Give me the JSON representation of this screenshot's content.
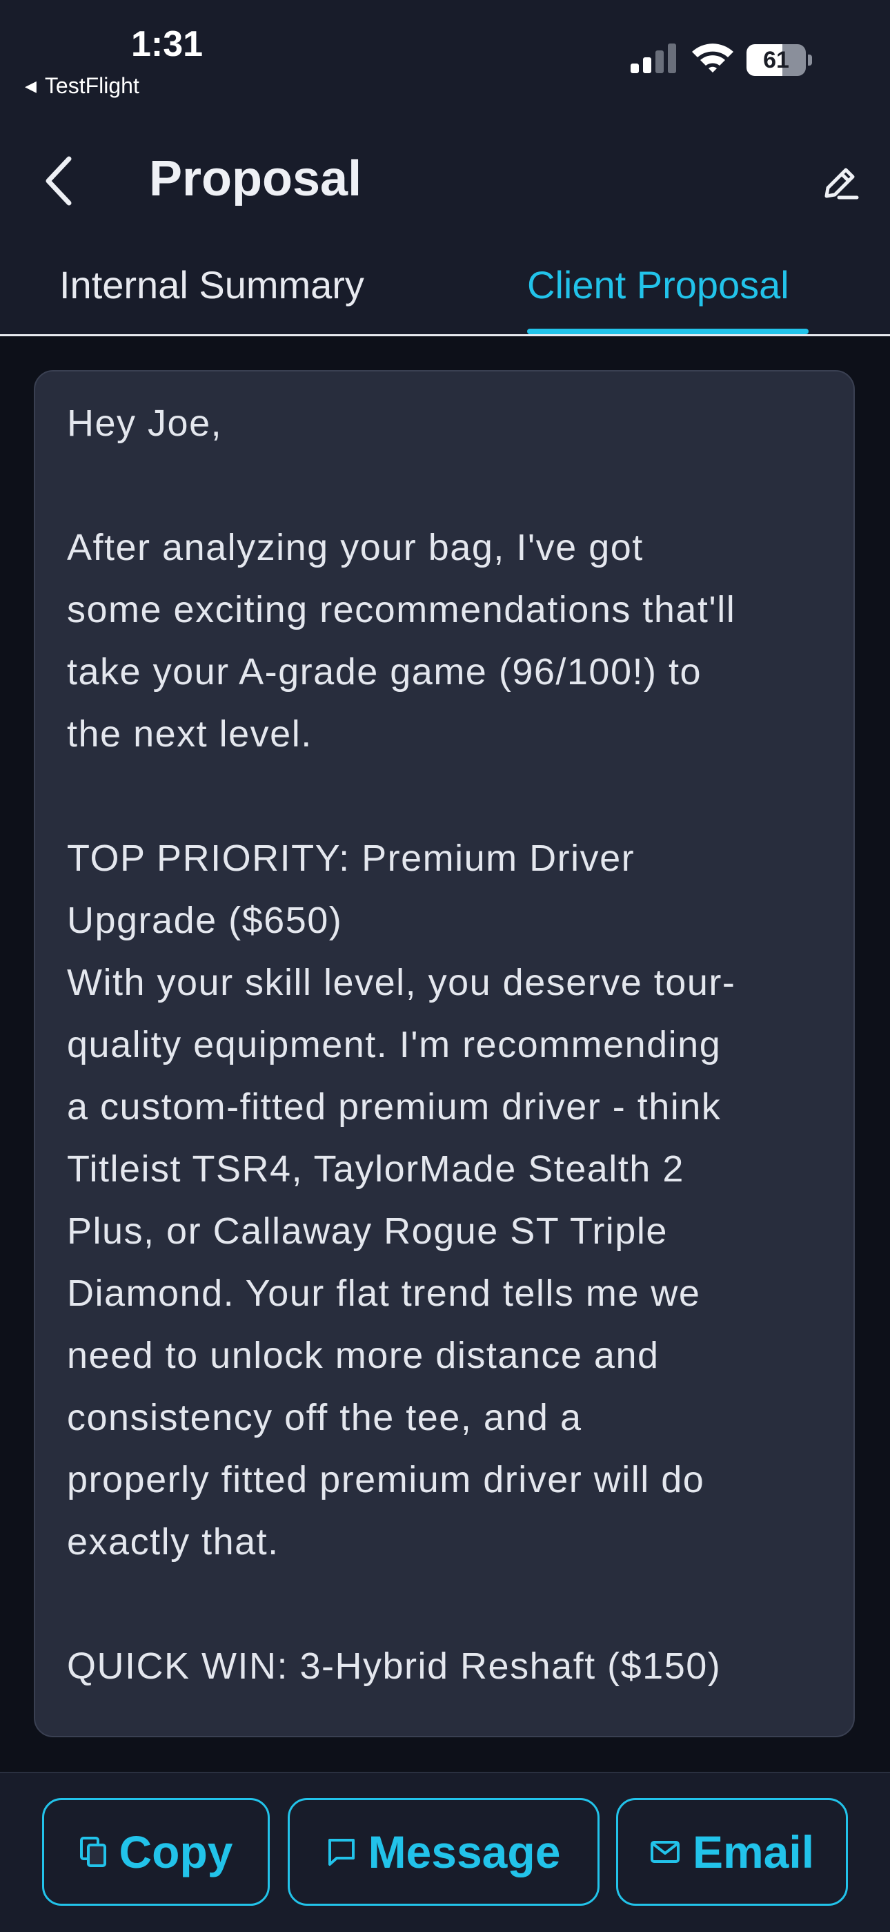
{
  "status_bar": {
    "time": "1:31",
    "back_app_label": "TestFlight",
    "battery_level": "61"
  },
  "nav": {
    "title": "Proposal"
  },
  "tabs": [
    {
      "label": "Internal Summary",
      "active": false
    },
    {
      "label": "Client Proposal",
      "active": true
    }
  ],
  "proposal": {
    "text": "Hey Joe,\n\nAfter analyzing your bag, I've got\nsome exciting recommendations that'll\ntake your A-grade game (96/100!) to\nthe next level.\n\nTOP PRIORITY: Premium Driver\nUpgrade ($650)\nWith your skill level, you deserve tour-\nquality equipment. I'm recommending\na custom-fitted premium driver - think\nTitleist TSR4, TaylorMade Stealth 2\nPlus, or Callaway Rogue ST Triple\nDiamond. Your flat trend tells me we\nneed to unlock more distance and\nconsistency off the tee, and a\nproperly fitted premium driver will do\nexactly that.\n\nQUICK WIN: 3-Hybrid Reshaft ($150)"
  },
  "actions": {
    "copy_label": "Copy",
    "message_label": "Message",
    "email_label": "Email"
  },
  "colors": {
    "accent": "#22c3ea",
    "background": "#0d1019",
    "header": "#181c2a",
    "card": "#282d3d"
  },
  "icons": [
    "back-triangle-icon",
    "signal-icon",
    "wifi-icon",
    "battery-icon",
    "chevron-left-icon",
    "edit-icon",
    "copy-icon",
    "message-icon",
    "mail-icon"
  ]
}
